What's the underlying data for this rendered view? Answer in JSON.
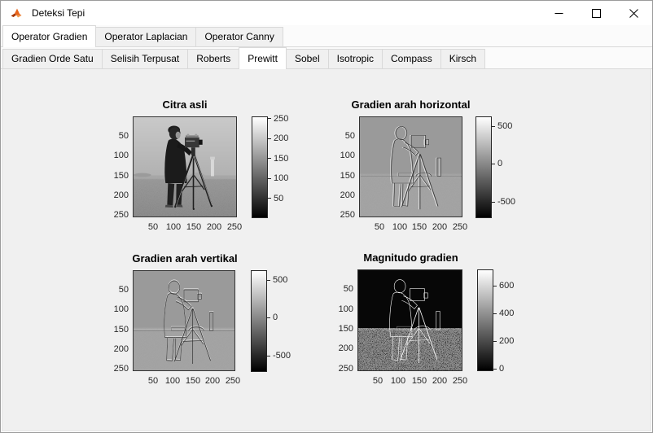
{
  "window": {
    "title": "Deteksi Tepi",
    "icons": {
      "app": "matlab-logo-icon",
      "minimize": "minimize-icon",
      "maximize": "maximize-icon",
      "close": "close-icon"
    }
  },
  "tabs": {
    "level1": {
      "items": [
        {
          "label": "Operator Gradien",
          "selected": true
        },
        {
          "label": "Operator Laplacian",
          "selected": false
        },
        {
          "label": "Operator Canny",
          "selected": false
        }
      ]
    },
    "level2": {
      "items": [
        {
          "label": "Gradien Orde Satu",
          "selected": false
        },
        {
          "label": "Selisih Terpusat",
          "selected": false
        },
        {
          "label": "Roberts",
          "selected": false
        },
        {
          "label": "Prewitt",
          "selected": true
        },
        {
          "label": "Sobel",
          "selected": false
        },
        {
          "label": "Isotropic",
          "selected": false
        },
        {
          "label": "Compass",
          "selected": false
        },
        {
          "label": "Kirsch",
          "selected": false
        }
      ]
    }
  },
  "chart_data": [
    {
      "type": "heatmap",
      "title": "Citra asli",
      "subject": "cameraman grayscale test image, 256x256",
      "colormap": "gray",
      "xticks": [
        50,
        100,
        150,
        200,
        250
      ],
      "yticks": [
        50,
        100,
        150,
        200,
        250
      ],
      "xlim": [
        1,
        256
      ],
      "ylim": [
        1,
        256
      ],
      "colorbar": {
        "ticks": [
          250,
          200,
          150,
          100,
          50
        ],
        "range": [
          0,
          255
        ]
      }
    },
    {
      "type": "heatmap",
      "title": "Gradien arah horizontal",
      "subject": "Prewitt horizontal gradient of cameraman image",
      "colormap": "gray",
      "xticks": [
        50,
        100,
        150,
        200,
        250
      ],
      "yticks": [
        50,
        100,
        150,
        200,
        250
      ],
      "xlim": [
        1,
        256
      ],
      "ylim": [
        1,
        256
      ],
      "colorbar": {
        "ticks": [
          500,
          0,
          -500
        ],
        "range": [
          -660,
          660
        ]
      }
    },
    {
      "type": "heatmap",
      "title": "Gradien arah vertikal",
      "subject": "Prewitt vertical gradient of cameraman image",
      "colormap": "gray",
      "xticks": [
        50,
        100,
        150,
        200,
        250
      ],
      "yticks": [
        50,
        100,
        150,
        200,
        250
      ],
      "xlim": [
        1,
        256
      ],
      "ylim": [
        1,
        256
      ],
      "colorbar": {
        "ticks": [
          500,
          0,
          -500
        ],
        "range": [
          -660,
          660
        ]
      }
    },
    {
      "type": "heatmap",
      "title": "Magnitudo gradien",
      "subject": "Prewitt gradient magnitude of cameraman image",
      "colormap": "gray",
      "xticks": [
        50,
        100,
        150,
        200,
        250
      ],
      "yticks": [
        50,
        100,
        150,
        200,
        250
      ],
      "xlim": [
        1,
        256
      ],
      "ylim": [
        1,
        256
      ],
      "colorbar": {
        "ticks": [
          600,
          400,
          200,
          0
        ],
        "range": [
          0,
          720
        ]
      }
    }
  ],
  "colors": {
    "figure_background": "#f0f0f0",
    "axis_text": "#262626",
    "tab_selected_bg": "#ffffff",
    "tab_bg": "#f0f0f0"
  }
}
